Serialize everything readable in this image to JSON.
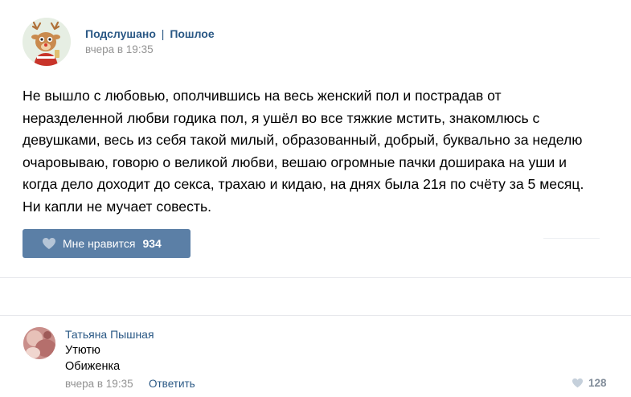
{
  "post": {
    "author_name": "Подслушано",
    "author_sep": "|",
    "author_sub": "Пошлое",
    "time": "вчера в 19:35",
    "text_lines": [
      "Не вышло с любовью, ополчившись на весь женский пол и пострадав от",
      "неразделенной любви годика пол, я ушёл во все тяжкие мстить, знакомлюсь с",
      "девушками, весь из себя такой милый, образованный, добрый, буквально за неделю",
      "очаровываю, говорю о великой любви, вешаю огромные пачки доширака на уши и",
      "когда дело доходит до секса, трахаю и кидаю, на днях была 21я по счёту за 5 месяц.",
      "Ни капли не мучает совесть."
    ],
    "like_label": "Мне нравится",
    "like_count": "934",
    "like_icon": "heart-icon",
    "avatar_icon": "deer-avatar"
  },
  "comment": {
    "author": "Татьяна Пышная",
    "line1": "Утютю",
    "line2": "Обиженка",
    "time": "вчера в 19:35",
    "reply_label": "Ответить",
    "like_count": "128",
    "like_icon": "heart-icon"
  },
  "colors": {
    "link": "#2a5885",
    "button": "#5b7fa6",
    "muted": "#939393"
  }
}
